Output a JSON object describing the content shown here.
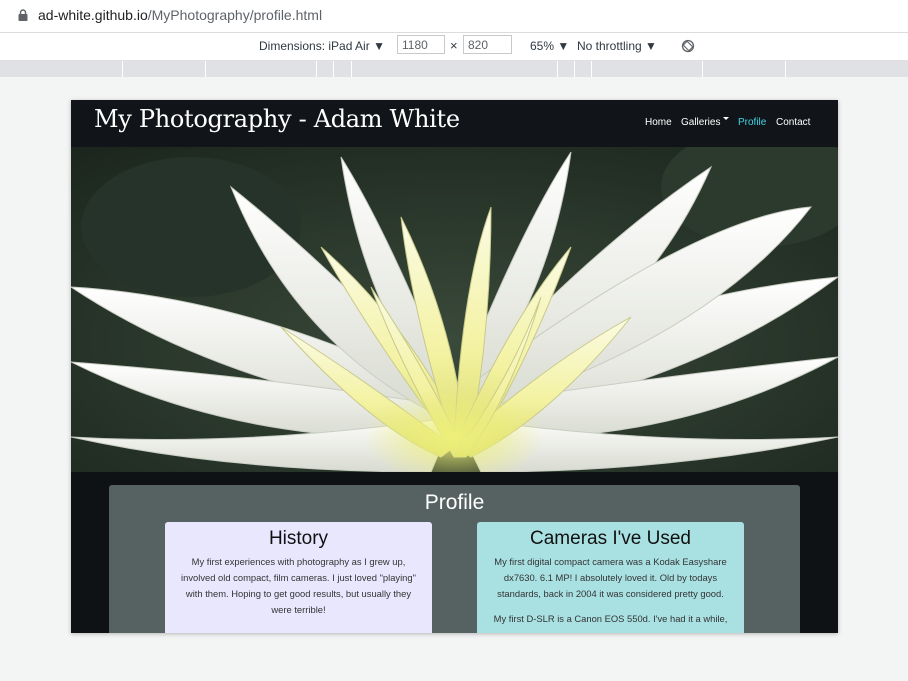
{
  "browser": {
    "url_host": "ad-white.github.io",
    "url_path": "/MyPhotography/profile.html"
  },
  "devtools": {
    "dimensions_label": "Dimensions: iPad Air",
    "width_value": "1180",
    "times": "×",
    "height_value": "820",
    "zoom": "65%",
    "throttling": "No throttling"
  },
  "site": {
    "brand": "My Photography - Adam White",
    "nav": {
      "home": "Home",
      "galleries": "Galleries",
      "profile": "Profile",
      "contact": "Contact"
    },
    "hero_image": "white-dahlia-flower-photo",
    "profile_heading": "Profile",
    "history": {
      "title": "History",
      "text": "My first experiences with photography as I grew up, involved old compact, film cameras. I just loved \"playing\" with them. Hoping to get good results, but usually they were terrible!"
    },
    "cameras": {
      "title": "Cameras I've Used",
      "text1": "My first digital compact camera was a Kodak Easyshare dx7630. 6.1 MP! I absolutely loved it. Old by todays standards, back in 2004 it was considered pretty good.",
      "text2": "My first D-SLR is a Canon EOS 550d. I've had it a while,"
    }
  },
  "colors": {
    "nav_active": "#3fd5e8",
    "panel": "#566261",
    "history_card": "#e9e7fe",
    "cameras_card": "#a9e1e3"
  }
}
